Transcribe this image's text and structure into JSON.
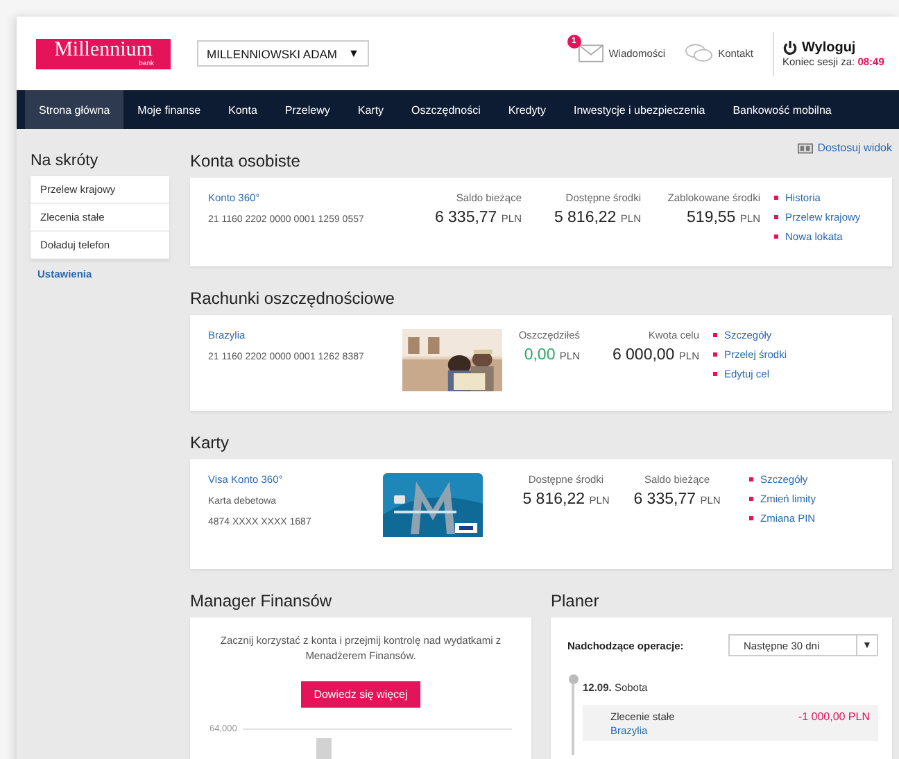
{
  "header": {
    "logo": {
      "name": "Millennium",
      "sub": "bank"
    },
    "user_select": {
      "value": "MILLENNIOWSKI ADAM",
      "caret": "▼"
    },
    "messages": {
      "label": "Wiadomości",
      "badge": "1"
    },
    "contact": {
      "label": "Kontakt"
    },
    "logout": {
      "label": "Wyloguj",
      "session_label": "Koniec sesji za:",
      "session_time": "08:49"
    }
  },
  "nav": [
    {
      "label": "Strona główna",
      "selected": true
    },
    {
      "label": "Moje finanse",
      "selected": false
    },
    {
      "label": "Konta",
      "selected": false
    },
    {
      "label": "Przelewy",
      "selected": false
    },
    {
      "label": "Karty",
      "selected": false
    },
    {
      "label": "Oszczędności",
      "selected": false
    },
    {
      "label": "Kredyty",
      "selected": false
    },
    {
      "label": "Inwestycje i ubezpieczenia",
      "selected": false
    },
    {
      "label": "Bankowość mobilna",
      "selected": false
    }
  ],
  "shortcuts": {
    "title": "Na skróty",
    "items": [
      "Przelew krajowy",
      "Zlecenia stałe",
      "Doładuj telefon"
    ],
    "settings_link": "Ustawienia"
  },
  "customize_link": "Dostosuj widok",
  "personal_accounts": {
    "title": "Konta osobiste",
    "accounts": [
      {
        "name": "Konto 360°",
        "number": "21 1160 2202 0000 0001 1259 0557",
        "figures": [
          {
            "label": "Saldo bieżące",
            "amount": "6 335,77",
            "currency": "PLN",
            "color": "#222222"
          },
          {
            "label": "Dostępne środki",
            "amount": "5 816,22",
            "currency": "PLN",
            "color": "#222222"
          },
          {
            "label": "Zablokowane środki",
            "amount": "519,55",
            "currency": "PLN",
            "color": "#222222"
          }
        ],
        "links": [
          "Historia",
          "Przelew krajowy",
          "Nowa lokata"
        ]
      }
    ]
  },
  "savings": {
    "title": "Rachunki oszczędnościowe",
    "accounts": [
      {
        "name": "Brazylia",
        "number": "21 1160 2202 0000 0001 1262 8387",
        "kind": "picture",
        "figures": [
          {
            "label": "Oszczędziłeś",
            "amount": "0,00",
            "currency": "PLN",
            "color": "#2aa866"
          },
          {
            "label": "Kwota celu",
            "amount": "6 000,00",
            "currency": "PLN",
            "color": "#222222"
          }
        ],
        "links": [
          "Szczegóły",
          "Przelej środki",
          "Edytuj cel"
        ]
      }
    ]
  },
  "cards": {
    "title": "Karty",
    "items": [
      {
        "name": "Visa Konto 360°",
        "type": "Karta debetowa",
        "number": "4874 XXXX XXXX 1687",
        "kind": "picture",
        "figures": [
          {
            "label": "Dostępne środki",
            "amount": "5 816,22",
            "currency": "PLN",
            "color": "#222222"
          },
          {
            "label": "Saldo bieżące",
            "amount": "6 335,77",
            "currency": "PLN",
            "color": "#222222"
          }
        ],
        "links": [
          "Szczegóły",
          "Zmień limity",
          "Zmiana PIN"
        ]
      }
    ]
  },
  "finance_manager": {
    "title": "Manager Finansów",
    "text": "Zacznij korzystać z konta i przejmij kontrolę nad wydatkami z Menadżerem Finansów.",
    "button": "Dowiedz się więcej",
    "axis_tick": "64,000"
  },
  "planner": {
    "title": "Planer",
    "filter_label": "Nadchodzące operacje:",
    "filter": {
      "value": "Następne 30 dni",
      "caret": "▼"
    },
    "days": [
      {
        "date": "12.09.",
        "weekday": "Sobota",
        "operations": [
          {
            "title": "Zlecenie stałe",
            "account": "Brazylia",
            "amount": "-1 000,00 PLN"
          }
        ]
      }
    ]
  }
}
